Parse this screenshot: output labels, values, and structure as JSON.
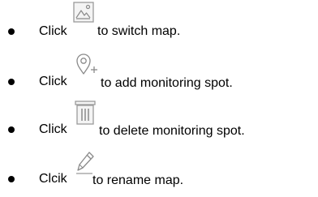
{
  "items": [
    {
      "lead": "Click",
      "icon": "map-picture-icon",
      "tail": "to switch map."
    },
    {
      "lead": "Click",
      "icon": "add-location-pin-icon",
      "tail": "to add monitoring spot."
    },
    {
      "lead": "Click",
      "icon": "trash-icon",
      "tail": "to delete monitoring spot."
    },
    {
      "lead": "Clcik",
      "icon": "pencil-edit-icon",
      "tail": "to rename map."
    }
  ],
  "colors": {
    "text": "#000000",
    "icon_stroke": "#8a8a8a",
    "icon_border": "#9a9a9a",
    "icon_fill": "#f4f4f4"
  }
}
